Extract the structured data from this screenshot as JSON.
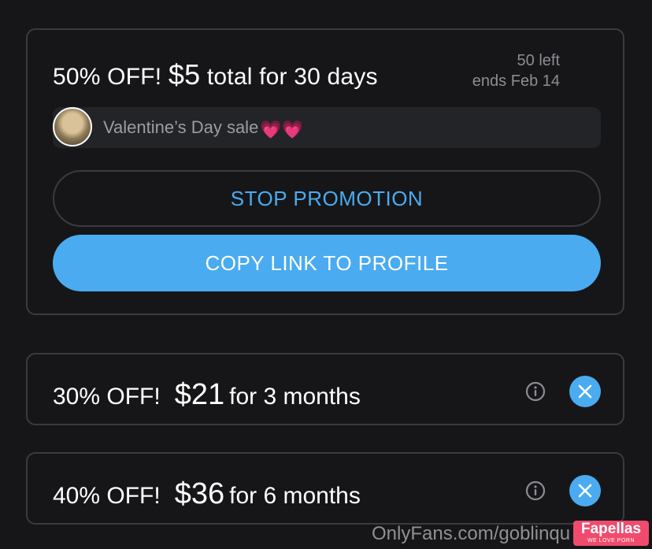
{
  "promo": {
    "title_prefix": "50% OFF!",
    "price": "$5",
    "title_suffix": "total for 30 days",
    "remaining": "50 left",
    "ends": "ends Feb 14",
    "message": "Valentine’s Day sale",
    "message_emoji": "💗💗",
    "stop_button": "STOP PROMOTION",
    "copy_button": "COPY LINK TO PROFILE"
  },
  "offers": [
    {
      "discount": "30% OFF!",
      "price": "$21",
      "duration": "for 3 months"
    },
    {
      "discount": "40% OFF!",
      "price": "$36",
      "duration": "for 6 months"
    }
  ],
  "watermark": {
    "url": "OnlyFans.com/goblinqu",
    "badge_name": "Fapellas",
    "badge_tagline": "WE LOVE PORN"
  },
  "colors": {
    "accent": "#4aabf0",
    "background": "#161618",
    "border": "#3a3b40",
    "muted_text": "#8a8d93"
  }
}
